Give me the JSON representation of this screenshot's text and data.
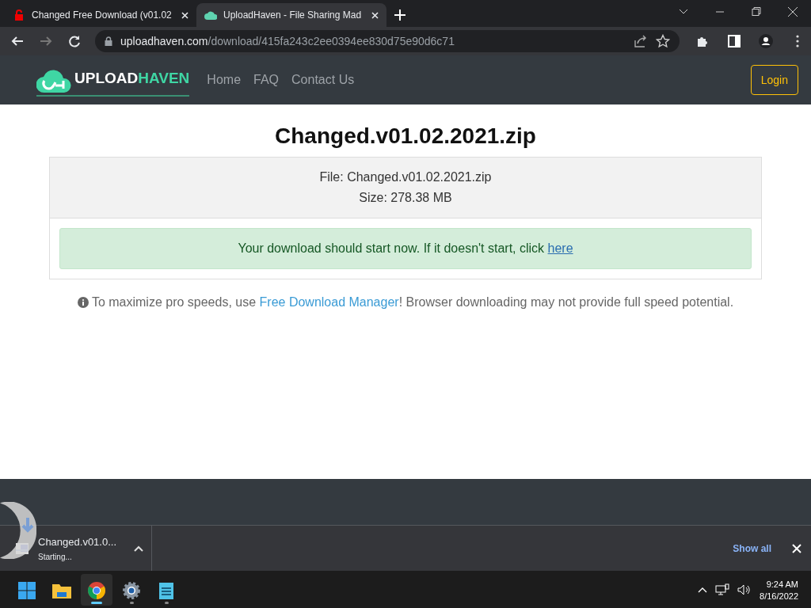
{
  "browser": {
    "tabs": [
      {
        "title": "Changed Free Download (v01.02",
        "selected": false,
        "kind": "lock"
      },
      {
        "title": "UploadHaven - File Sharing Mad",
        "selected": true,
        "kind": "cloud"
      }
    ],
    "address": {
      "domain": "uploadhaven.com",
      "path": "/download/415fa243c2ee0394ee830d75e90d6c71"
    }
  },
  "site": {
    "logo": {
      "first": "UPLOAD",
      "second": "HAVEN"
    },
    "nav": [
      "Home",
      "FAQ",
      "Contact Us"
    ],
    "login": "Login"
  },
  "file": {
    "title": "Changed.v01.02.2021.zip",
    "name_line": "File: Changed.v01.02.2021.zip",
    "size_line": "Size: 278.38 MB",
    "alert": {
      "text": "Your download should start now. If it doesn't start, click ",
      "link": "here"
    },
    "note": {
      "before": "To maximize pro speeds, use ",
      "link": "Free Download Manager",
      "after": "! Browser downloading may not provide full speed potential."
    }
  },
  "downloads": {
    "item": {
      "name": "Changed.v01.0...",
      "status": "Starting..."
    },
    "show_all": "Show all"
  },
  "taskbar": {
    "apps": [
      {
        "kind": "start",
        "selected": false,
        "running": false
      },
      {
        "kind": "folder",
        "selected": false,
        "running": false
      },
      {
        "kind": "chrome",
        "selected": true,
        "running": true
      },
      {
        "kind": "settings",
        "selected": false,
        "running": true
      },
      {
        "kind": "notepad",
        "selected": false,
        "running": true
      }
    ],
    "time": "9:24 AM",
    "date": "8/16/2022"
  }
}
